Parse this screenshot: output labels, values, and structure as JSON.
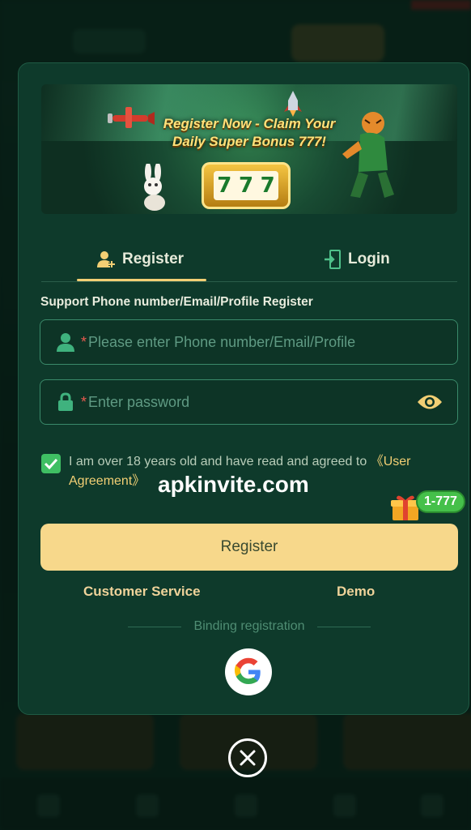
{
  "banner": {
    "headline_line1": "Register Now - Claim Your",
    "headline_line2": "Daily Super Bonus 777!",
    "slot_reels": [
      "7",
      "7",
      "7"
    ]
  },
  "tabs": [
    {
      "label": "Register",
      "icon": "add-user-icon",
      "active": true
    },
    {
      "label": "Login",
      "icon": "door-enter-icon",
      "active": false
    }
  ],
  "form": {
    "support_text": "Support Phone number/Email/Profile Register",
    "phone_field": {
      "required_mark": "*",
      "placeholder": "Please enter Phone number/Email/Profile",
      "value": ""
    },
    "password_field": {
      "required_mark": "*",
      "placeholder": "Enter password",
      "value": ""
    },
    "agreement": {
      "checked": true,
      "text": "I am over 18 years old and have read and agreed to ",
      "link_text": "《User Agreement》"
    },
    "register_button": "Register"
  },
  "bonus_badge": "1-777",
  "watermark": "apkinvite.com",
  "links": {
    "customer_service": "Customer Service",
    "demo": "Demo"
  },
  "binding_label": "Binding registration",
  "colors": {
    "modal_bg": "#0e3a2b",
    "accent_gold": "#f2cf74",
    "button_bg": "#f7d88b",
    "field_border": "#3a8a6a",
    "checkbox_green": "#3fbf63"
  }
}
